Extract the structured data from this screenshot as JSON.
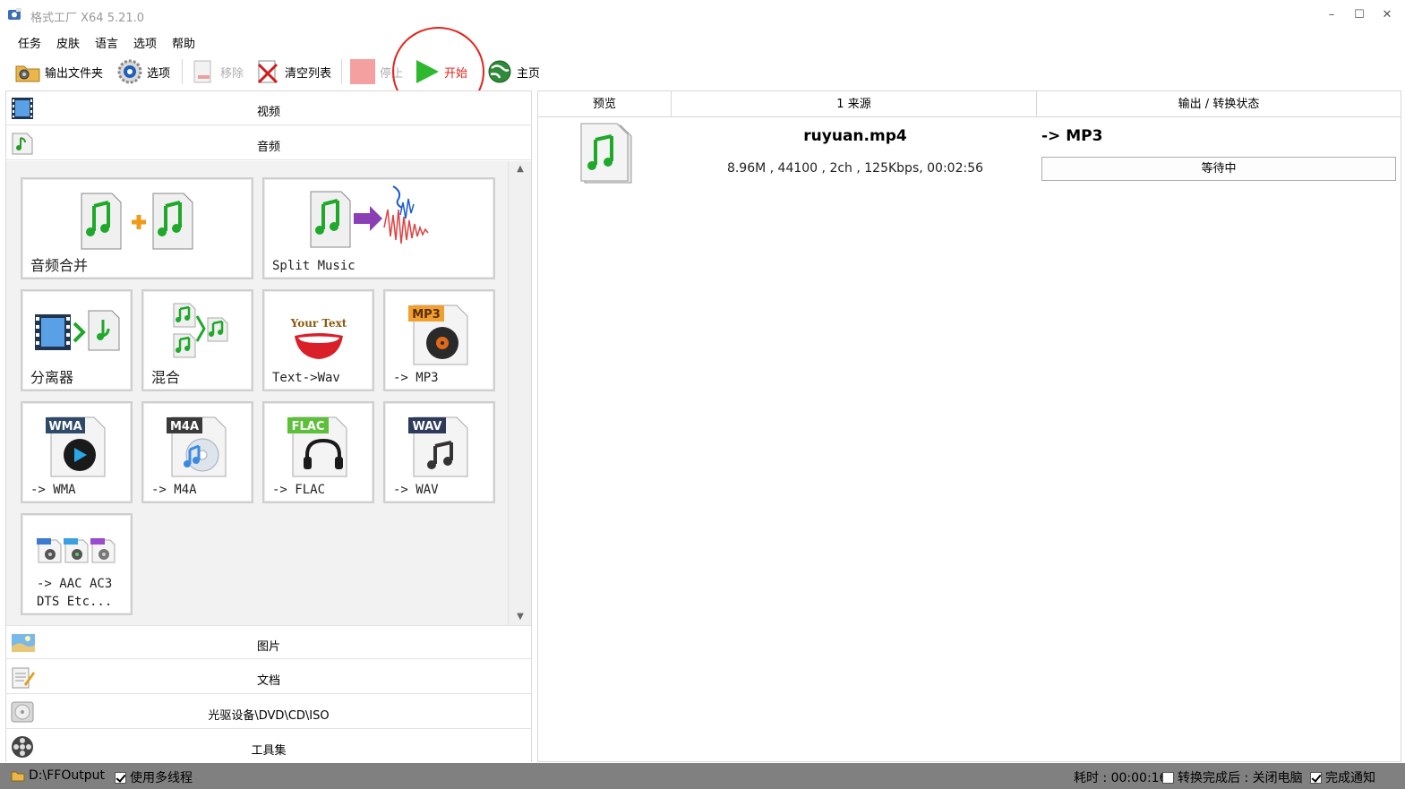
{
  "window": {
    "title": "格式工厂 X64 5.21.0",
    "minimize": "–",
    "maximize": "☐",
    "close": "✕"
  },
  "menu": [
    "任务",
    "皮肤",
    "语言",
    "选项",
    "帮助"
  ],
  "toolbar": {
    "output_folder": "输出文件夹",
    "options": "选项",
    "remove": "移除",
    "clear_list": "清空列表",
    "stop": "停止",
    "start": "开始",
    "home": "主页"
  },
  "categories": {
    "video": "视频",
    "audio": "音频",
    "picture": "图片",
    "document": "文档",
    "optical": "光驱设备\\DVD\\CD\\ISO",
    "tools": "工具集"
  },
  "audio_tiles": {
    "merge": "音频合并",
    "split": "Split Music",
    "splitter": "分离器",
    "mix": "混合",
    "text_wav": "Text->Wav",
    "to_mp3": "-> MP3",
    "to_wma": "-> WMA",
    "to_m4a": "-> M4A",
    "to_flac": "-> FLAC",
    "to_wav": "-> WAV",
    "to_aac_1": "-> AAC AC3",
    "to_aac_2": "DTS Etc..."
  },
  "badges": {
    "mp3": "MP3",
    "wma": "WMA",
    "m4a": "M4A",
    "flac": "FLAC",
    "wav": "WAV",
    "your_text": "Your Text"
  },
  "task_list": {
    "col_preview": "预览",
    "col_source": "1 来源",
    "col_output": "输出 / 转换状态",
    "rows": [
      {
        "file_name": "ruyuan.mp4",
        "info": "8.96M , 44100 , 2ch , 125Kbps, 00:02:56",
        "output": "-> MP3",
        "status": "等待中"
      }
    ]
  },
  "statusbar": {
    "output_path": "D:\\FFOutput",
    "multithread": "使用多线程",
    "elapsed": "耗时 : 00:00:16",
    "after_convert": "转换完成后 : 关闭电脑",
    "notify": "完成通知"
  },
  "colors": {
    "accent_red": "#e4231d",
    "play_green": "#2db82d",
    "statusbar_gray": "#808080"
  }
}
